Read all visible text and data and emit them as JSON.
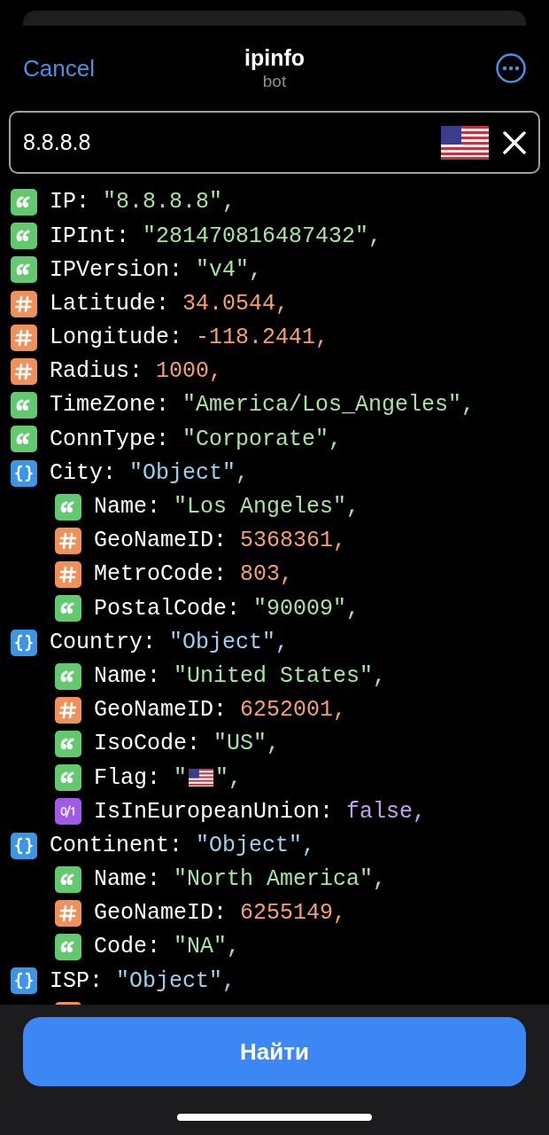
{
  "header": {
    "cancel": "Cancel",
    "title": "ipinfo",
    "subtitle": "bot"
  },
  "search": {
    "value": "8.8.8.8"
  },
  "fields": [
    {
      "kind": "string",
      "key": "IP:",
      "value": "\"8.8.8.8\","
    },
    {
      "kind": "string",
      "key": "IPInt:",
      "value": "\"281470816487432\","
    },
    {
      "kind": "string",
      "key": "IPVersion:",
      "value": "\"v4\","
    },
    {
      "kind": "number",
      "key": "Latitude:",
      "value": "34.0544,"
    },
    {
      "kind": "number",
      "key": "Longitude:",
      "value": "-118.2441,"
    },
    {
      "kind": "number",
      "key": "Radius:",
      "value": "1000,"
    },
    {
      "kind": "string",
      "key": "TimeZone:",
      "value": "\"America/Los_Angeles\","
    },
    {
      "kind": "string",
      "key": "ConnType:",
      "value": "\"Corporate\","
    },
    {
      "kind": "object",
      "key": "City:",
      "value": "\"Object\",",
      "children": [
        {
          "kind": "string",
          "key": "Name:",
          "value": "\"Los Angeles\","
        },
        {
          "kind": "number",
          "key": "GeoNameID:",
          "value": "5368361,"
        },
        {
          "kind": "number",
          "key": "MetroCode:",
          "value": "803,"
        },
        {
          "kind": "string",
          "key": "PostalCode:",
          "value": "\"90009\","
        }
      ]
    },
    {
      "kind": "object",
      "key": "Country:",
      "value": "\"Object\",",
      "children": [
        {
          "kind": "string",
          "key": "Name:",
          "value": "\"United States\","
        },
        {
          "kind": "number",
          "key": "GeoNameID:",
          "value": "6252001,"
        },
        {
          "kind": "string",
          "key": "IsoCode:",
          "value": "\"US\","
        },
        {
          "kind": "string",
          "key": "Flag:",
          "value_open": "\"",
          "value_close": "\",",
          "flag": true
        },
        {
          "kind": "boolean",
          "key": "IsInEuropeanUnion:",
          "value": "false,"
        }
      ]
    },
    {
      "kind": "object",
      "key": "Continent:",
      "value": "\"Object\",",
      "children": [
        {
          "kind": "string",
          "key": "Name:",
          "value": "\"North America\","
        },
        {
          "kind": "number",
          "key": "GeoNameID:",
          "value": "6255149,"
        },
        {
          "kind": "string",
          "key": "Code:",
          "value": "\"NA\","
        }
      ]
    },
    {
      "kind": "object",
      "key": "ISP:",
      "value": "\"Object\",",
      "children": [
        {
          "kind": "number"
        }
      ]
    }
  ],
  "button": "Найти"
}
